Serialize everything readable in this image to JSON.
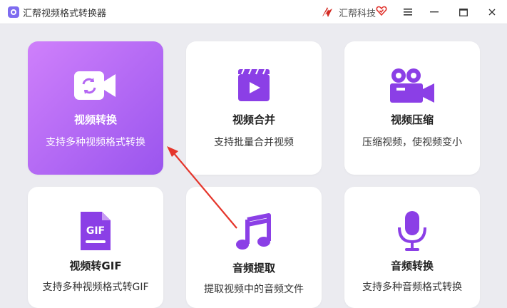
{
  "window": {
    "title": "汇帮视频格式转换器",
    "brand": "汇帮科技"
  },
  "cards": [
    {
      "title": "视频转换",
      "desc": "支持多种视频格式转换",
      "icon": "video-convert-icon",
      "active": true
    },
    {
      "title": "视频合并",
      "desc": "支持批量合并视频",
      "icon": "video-play-icon"
    },
    {
      "title": "视频压缩",
      "desc": "压缩视频，使视频变小",
      "icon": "camera-icon"
    },
    {
      "title": "视频转GIF",
      "desc": "支持多种视频格式转GIF",
      "icon": "gif-file-icon"
    },
    {
      "title": "音频提取",
      "desc": "提取视频中的音频文件",
      "icon": "music-note-icon"
    },
    {
      "title": "音频转换",
      "desc": "支持多种音频格式转换",
      "icon": "microphone-icon"
    }
  ],
  "colors": {
    "accent_start": "#cf80fb",
    "accent_end": "#9a55ee",
    "icon": "#8b3fe6",
    "arrow": "#e5352b",
    "background": "#ebebf0"
  }
}
